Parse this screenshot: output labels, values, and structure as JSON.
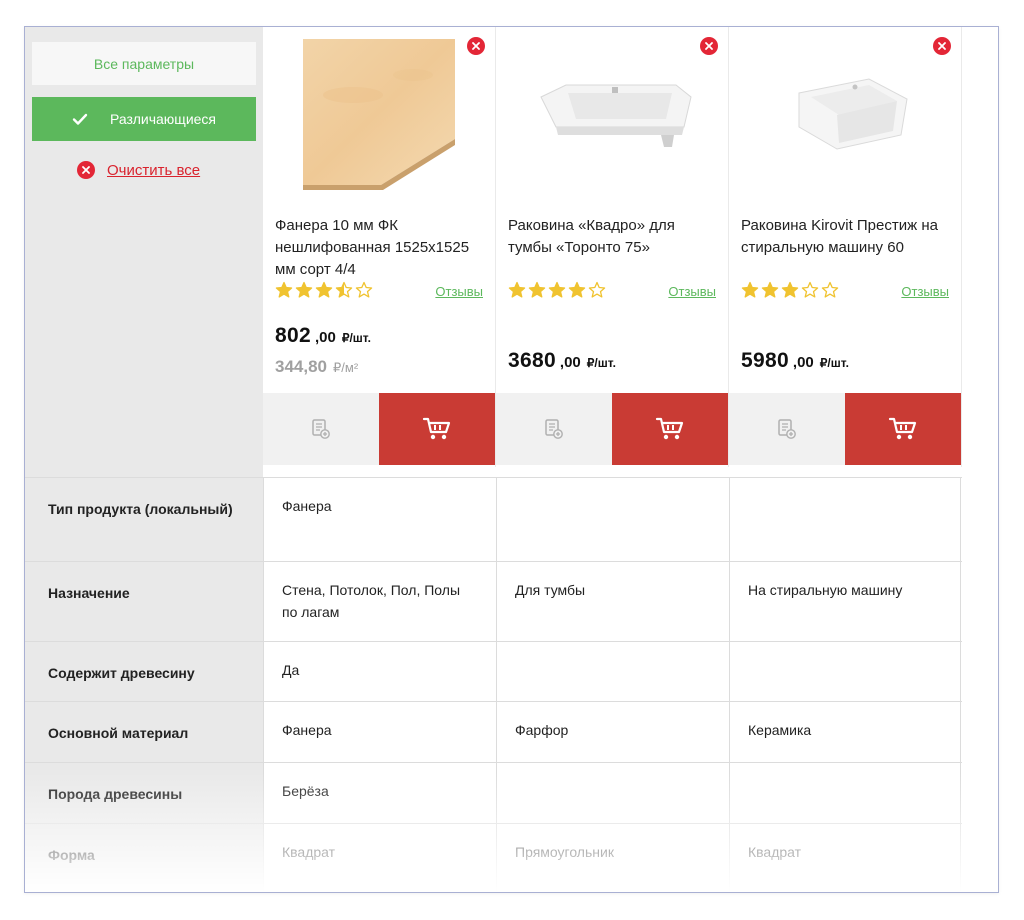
{
  "controls": {
    "all_params_label": "Все параметры",
    "different_label": "Различающиеся",
    "clear_all_label": "Очистить все"
  },
  "products": [
    {
      "name": "Фанера 10 мм ФК нешлифованная 1525х1525 мм сорт 4/4",
      "rating": 3.5,
      "reviews_label": "Отзывы",
      "price_int": "802",
      "price_dec": ",00",
      "price_unit": "₽/шт.",
      "price_sub": "344,80",
      "price_sub_unit": "₽/м²",
      "image_icon": "plywood-image"
    },
    {
      "name": "Раковина «Квадро» для тумбы «Торонто 75»",
      "rating": 4,
      "reviews_label": "Отзывы",
      "price_int": "3680",
      "price_dec": ",00",
      "price_unit": "₽/шт.",
      "image_icon": "sink-image"
    },
    {
      "name": "Раковина Kirovit Престиж на стиральную машину 60",
      "rating": 3,
      "reviews_label": "Отзывы",
      "price_int": "5980",
      "price_dec": ",00",
      "price_unit": "₽/шт.",
      "image_icon": "sink-square-image"
    }
  ],
  "specs": [
    {
      "label": "Тип продукта (локальный)",
      "values": [
        "Фанера",
        "",
        ""
      ]
    },
    {
      "label": "Назначение",
      "values": [
        "Стена, Потолок, Пол, Полы по лагам",
        "Для тумбы",
        "На стиральную машину"
      ]
    },
    {
      "label": "Содержит древесину",
      "values": [
        "Да",
        "",
        ""
      ]
    },
    {
      "label": "Основной материал",
      "values": [
        "Фанера",
        "Фарфор",
        "Керамика"
      ]
    },
    {
      "label": "Порода древесины",
      "values": [
        "Берёза",
        "",
        ""
      ]
    },
    {
      "label": "Форма",
      "values": [
        "Квадрат",
        "Прямоугольник",
        "Квадрат"
      ]
    }
  ],
  "colors": {
    "accent_green": "#5cb85c",
    "cart_red": "#c93b34",
    "remove_red": "#e32636",
    "star": "#f0c330"
  }
}
